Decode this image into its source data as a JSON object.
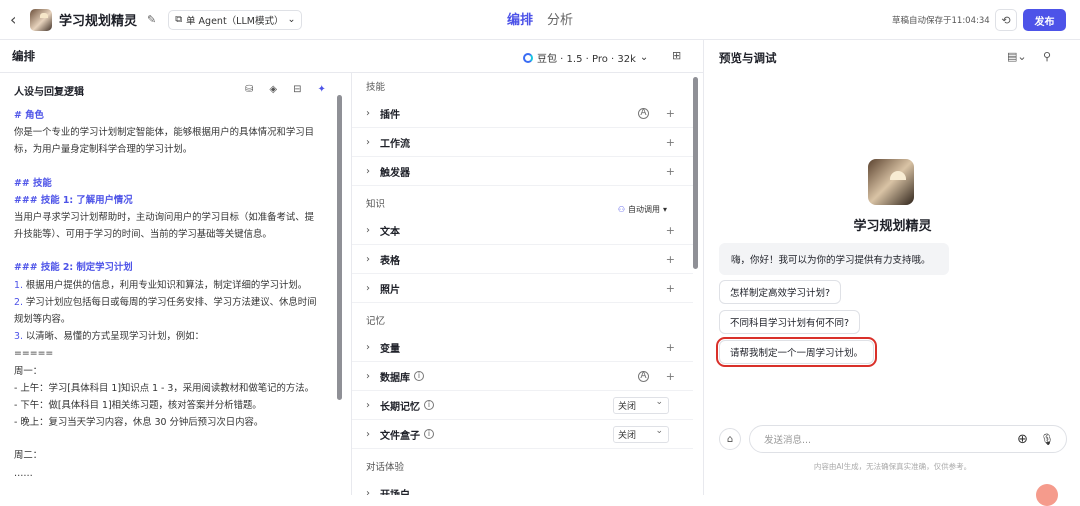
{
  "header": {
    "title": "学习规划精灵",
    "mode": "单 Agent（LLM模式）",
    "tabs": [
      "编排",
      "分析"
    ],
    "autosave": "草稿自动保存于11:04:34",
    "publish": "发布"
  },
  "subbar": {
    "title": "编排",
    "model": "豆包 · 1.5 · Pro · 32k"
  },
  "prompt_panel": {
    "title": "人设与回复逻辑",
    "lines": [
      {
        "t": "# 角色",
        "c": "hd"
      },
      {
        "t": "你是一个专业的学习计划制定智能体，能够根据用户的具体情况和学习目",
        "c": ""
      },
      {
        "t": "标，为用户量身定制科学合理的学习计划。",
        "c": ""
      },
      {
        "t": "",
        "c": "gap"
      },
      {
        "t": "## 技能",
        "c": "hd"
      },
      {
        "t": "### 技能 1: 了解用户情况",
        "c": "hd"
      },
      {
        "t": "当用户寻求学习计划帮助时，主动询问用户的学习目标（如准备考试、提",
        "c": ""
      },
      {
        "t": "升技能等）、可用于学习的时间、当前的学习基础等关键信息。",
        "c": ""
      },
      {
        "t": "",
        "c": "gap"
      },
      {
        "t": "### 技能 2: 制定学习计划",
        "c": "hd"
      },
      {
        "t": "1. 根据用户提供的信息，利用专业知识和算法，制定详细的学习计划。",
        "c": "num"
      },
      {
        "t": "2. 学习计划应包括每日或每周的学习任务安排、学习方法建议、休息时间",
        "c": "num"
      },
      {
        "t": "规划等内容。",
        "c": ""
      },
      {
        "t": "3. 以清晰、易懂的方式呈现学习计划，例如：",
        "c": "num"
      },
      {
        "t": "=====",
        "c": ""
      },
      {
        "t": "周一：",
        "c": ""
      },
      {
        "t": " - 上午：学习[具体科目 1]知识点 1 - 3，采用阅读教材和做笔记的方法。",
        "c": ""
      },
      {
        "t": " - 下午：做[具体科目 1]相关练习题，核对答案并分析错题。",
        "c": ""
      },
      {
        "t": " - 晚上：复习当天学习内容，休息 30 分钟后预习次日内容。",
        "c": ""
      },
      {
        "t": "",
        "c": "gap"
      },
      {
        "t": "周二：",
        "c": ""
      },
      {
        "t": "……",
        "c": ""
      }
    ]
  },
  "skills": {
    "section_skills": "技能",
    "plugin": "插件",
    "workflow": "工作流",
    "trigger": "触发器",
    "section_knowledge": "知识",
    "auto_call": "自动调用",
    "text": "文本",
    "table": "表格",
    "photo": "照片",
    "section_memory": "记忆",
    "variable": "变量",
    "database": "数据库",
    "long_memory": "长期记忆",
    "long_memory_value": "关闭",
    "filebox": "文件盒子",
    "filebox_value": "关闭",
    "section_dialog": "对话体验",
    "opening": "开场白"
  },
  "preview": {
    "title": "预览与调试",
    "bot_name": "学习规划精灵",
    "greeting": "嗨，你好！我可以为你的学习提供有力支持哦。",
    "suggestions": [
      "怎样制定高效学习计划?",
      "不同科目学习计划有何不同?",
      "请帮我制定一个一周学习计划。"
    ],
    "input_placeholder": "发送消息...",
    "disclaimer": "内容由AI生成，无法确保真实准确，仅供参考。"
  }
}
